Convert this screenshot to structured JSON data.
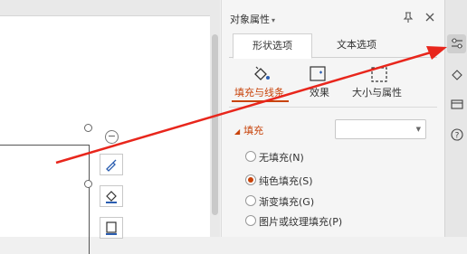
{
  "canvas": {
    "quick_tools": [
      "brush-icon",
      "fill-bucket-icon",
      "outline-icon"
    ]
  },
  "panel": {
    "title": "对象属性",
    "title_caret": "▾",
    "tabs": [
      {
        "label": "形状选项",
        "active": true
      },
      {
        "label": "文本选项",
        "active": false
      }
    ],
    "sub_tabs": [
      {
        "label": "填充与线条",
        "icon": "fill-line-icon",
        "active": true
      },
      {
        "label": "效果",
        "icon": "effects-icon",
        "active": false
      },
      {
        "label": "大小与属性",
        "icon": "size-properties-icon",
        "active": false
      }
    ],
    "section": {
      "header": "填充",
      "expand_glyph": "◢",
      "dropdown_value": "",
      "options": [
        {
          "label": "无填充(N)",
          "checked": false
        },
        {
          "label": "纯色填充(S)",
          "checked": true
        },
        {
          "label": "渐变填充(G)",
          "checked": false
        },
        {
          "label": "图片或纹理填充(P)",
          "checked": false
        }
      ]
    }
  },
  "right_toolbar": {
    "buttons": [
      {
        "icon": "properties-sliders-icon",
        "active": true
      },
      {
        "icon": "style-brush-icon",
        "active": false
      },
      {
        "icon": "window-icon",
        "active": false
      },
      {
        "icon": "help-icon",
        "active": false
      }
    ]
  },
  "annotation": {
    "color": "#e8261c"
  },
  "colors": {
    "accent": "#c8430a",
    "panel_bg": "#f5f5f5",
    "canvas_bg": "#ffffff"
  }
}
